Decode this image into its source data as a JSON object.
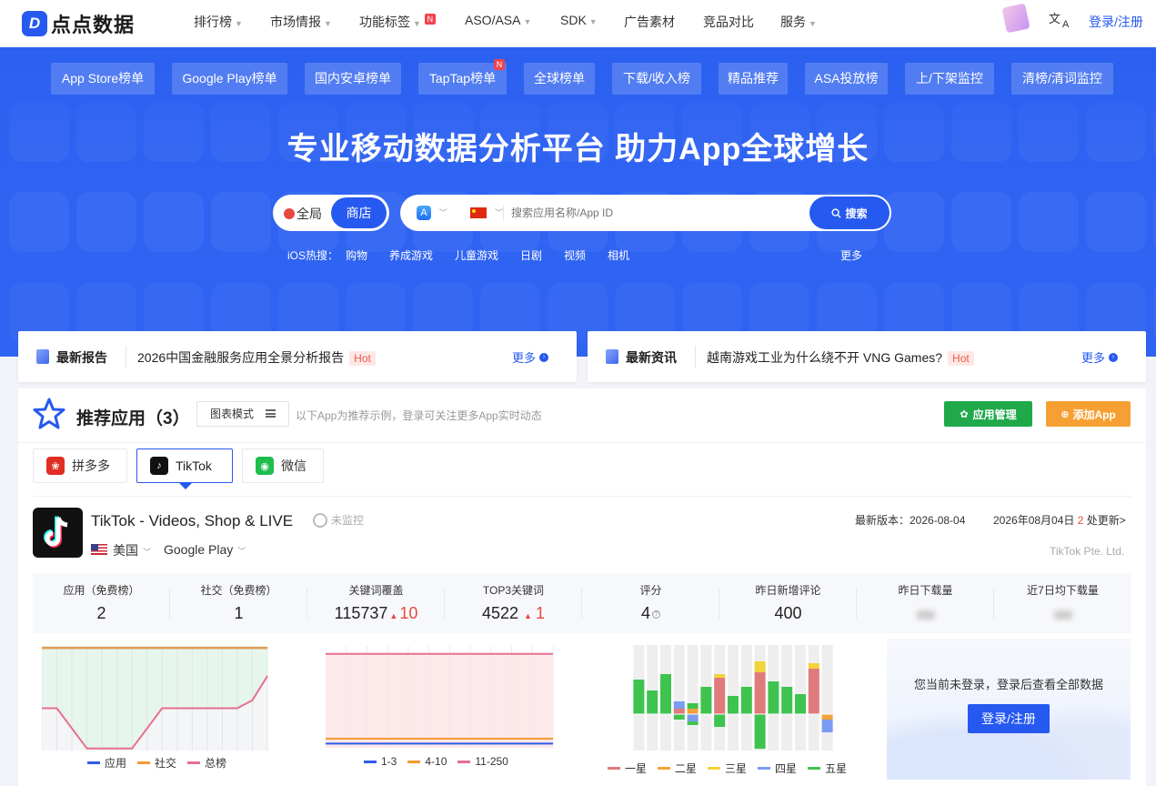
{
  "brand": {
    "logo_mark": "D",
    "name": "点点数据"
  },
  "nav": {
    "items": [
      {
        "label": "排行榜",
        "caret": true
      },
      {
        "label": "市场情报",
        "caret": true
      },
      {
        "label": "功能标签",
        "caret": true,
        "badge": "N"
      },
      {
        "label": "ASO/ASA",
        "caret": true
      },
      {
        "label": "SDK",
        "caret": true
      },
      {
        "label": "广告素材",
        "caret": false
      },
      {
        "label": "竞品对比",
        "caret": false
      },
      {
        "label": "服务",
        "caret": true
      }
    ],
    "lang_icon_top": "文",
    "lang_icon_bottom": "A",
    "login": "登录/注册"
  },
  "hero": {
    "tabs": [
      "App Store榜单",
      "Google Play榜单",
      "国内安卓榜单",
      "TapTap榜单",
      "全球榜单",
      "下载/收入榜",
      "精品推荐",
      "ASA投放榜",
      "上/下架监控",
      "清榜/清词监控"
    ],
    "taptap_badge": "N",
    "title": "专业移动数据分析平台  助力App全球增长",
    "scope_all": "全局",
    "scope_store": "商店",
    "search_placeholder": "搜索应用名称/App ID",
    "search_button": "搜索",
    "hot_label": "iOS热搜：",
    "hot_terms": [
      "购物",
      "养成游戏",
      "儿童游戏",
      "日剧",
      "视频",
      "相机"
    ],
    "more": "更多"
  },
  "news": [
    {
      "title": "最新报告",
      "text": "2026中国金融服务应用全景分析报告",
      "tag": "Hot",
      "more": "更多"
    },
    {
      "title": "最新资讯",
      "text": "越南游戏工业为什么绕不开 VNG Games?",
      "tag": "Hot",
      "more": "更多"
    }
  ],
  "recommend": {
    "title": "推荐应用（3）",
    "mode": "图表模式",
    "hint": "以下App为推荐示例，登录可关注更多App实时动态",
    "manage_btn": "应用管理",
    "add_btn": "添加App",
    "tabs": [
      {
        "label": "拼多多",
        "color": "#e02e24"
      },
      {
        "label": "TikTok",
        "color": "#111111"
      },
      {
        "label": "微信",
        "color": "#1fbd4e"
      }
    ]
  },
  "app": {
    "name": "TikTok - Videos, Shop & LIVE",
    "monitor": "未监控",
    "country": "美国",
    "platform": "Google Play",
    "version": "最新版本：2026-08-04",
    "update_prefix": "2026年08月04日 ",
    "update_count": "2",
    "update_suffix": " 处更新>",
    "developer": "TikTok Pte. Ltd."
  },
  "stats": [
    {
      "label": "应用（免费榜）",
      "value": "2"
    },
    {
      "label": "社交（免费榜）",
      "value": "1"
    },
    {
      "label": "关键词覆盖",
      "value": "115737",
      "delta": "10"
    },
    {
      "label": "TOP3关键词",
      "value": "4522",
      "delta": "1"
    },
    {
      "label": "评分",
      "value": "4"
    },
    {
      "label": "昨日新增评论",
      "value": "400"
    },
    {
      "label": "昨日下载量",
      "value": ""
    },
    {
      "label": "近7日均下载量",
      "value": ""
    }
  ],
  "chart_data": [
    {
      "type": "line",
      "series": [
        {
          "name": "应用",
          "color": "#2f5bea",
          "values": [
            1,
            1,
            1,
            1,
            1,
            1,
            1,
            1,
            1,
            1,
            1,
            1,
            1,
            1,
            1,
            1
          ]
        },
        {
          "name": "社交",
          "color": "#f39b33",
          "values": [
            1,
            1,
            1,
            1,
            1,
            1,
            1,
            1,
            1,
            1,
            1,
            1,
            1,
            1,
            1,
            1
          ]
        },
        {
          "name": "总榜",
          "color": "#e6708f",
          "values": [
            4,
            4,
            5,
            6,
            6,
            6,
            6,
            5,
            4,
            4,
            4,
            4,
            4,
            4,
            3.6,
            2.4
          ]
        }
      ],
      "ylim": [
        0.9,
        6.1
      ]
    },
    {
      "type": "line",
      "series": [
        {
          "name": "1-3",
          "color": "#2f5bea",
          "values": [
            4522,
            4522,
            4522,
            4522,
            4522,
            4522,
            4522,
            4522,
            4522,
            4522,
            4522,
            4522
          ]
        },
        {
          "name": "4-10",
          "color": "#f39b33",
          "values": [
            9800,
            9800,
            9800,
            9800,
            9800,
            9800,
            9800,
            9800,
            9800,
            9800,
            9800,
            9800
          ]
        },
        {
          "name": "11-250",
          "color": "#e6708f",
          "values": [
            101400,
            101400,
            101400,
            101400,
            101400,
            101400,
            101400,
            101400,
            101400,
            101400,
            101400,
            101400
          ]
        }
      ],
      "ylim": [
        0,
        110000
      ]
    },
    {
      "type": "bar",
      "stacked": true,
      "series": [
        {
          "name": "一星",
          "color": "#e07b7b"
        },
        {
          "name": "二星",
          "color": "#f2a33a"
        },
        {
          "name": "三星",
          "color": "#f3d33a"
        },
        {
          "name": "四星",
          "color": "#7b9cf0"
        },
        {
          "name": "五星",
          "color": "#3fc34f"
        }
      ],
      "bars": [
        {
          "pos": [
            0,
            0,
            0,
            0,
            38
          ],
          "neg": [
            0,
            0,
            0,
            0,
            0
          ]
        },
        {
          "pos": [
            0,
            0,
            0,
            0,
            26
          ],
          "neg": [
            0,
            0,
            0,
            0,
            0
          ]
        },
        {
          "pos": [
            0,
            0,
            0,
            0,
            44
          ],
          "neg": [
            0,
            0,
            0,
            0,
            0
          ]
        },
        {
          "pos": [
            6,
            0,
            0,
            8,
            0
          ],
          "neg": [
            0,
            0,
            0,
            0,
            6
          ]
        },
        {
          "pos": [
            0,
            6,
            0,
            0,
            6
          ],
          "neg": [
            0,
            0,
            0,
            8,
            4
          ]
        },
        {
          "pos": [
            0,
            0,
            0,
            0,
            30
          ],
          "neg": [
            0,
            0,
            0,
            0,
            0
          ]
        },
        {
          "pos": [
            40,
            0,
            4,
            0,
            0
          ],
          "neg": [
            0,
            0,
            0,
            0,
            14
          ]
        },
        {
          "pos": [
            0,
            0,
            0,
            0,
            20
          ],
          "neg": [
            0,
            0,
            0,
            0,
            0
          ]
        },
        {
          "pos": [
            0,
            0,
            0,
            0,
            30
          ],
          "neg": [
            0,
            0,
            0,
            0,
            0
          ]
        },
        {
          "pos": [
            46,
            0,
            12,
            0,
            0
          ],
          "neg": [
            0,
            0,
            0,
            0,
            38
          ]
        },
        {
          "pos": [
            0,
            0,
            0,
            0,
            36
          ],
          "neg": [
            0,
            0,
            0,
            0,
            0
          ]
        },
        {
          "pos": [
            0,
            0,
            0,
            0,
            30
          ],
          "neg": [
            0,
            0,
            0,
            0,
            0
          ]
        },
        {
          "pos": [
            0,
            0,
            0,
            0,
            22
          ],
          "neg": [
            0,
            0,
            0,
            0,
            0
          ]
        },
        {
          "pos": [
            50,
            0,
            6,
            0,
            0
          ],
          "neg": [
            0,
            0,
            0,
            0,
            0
          ]
        },
        {
          "pos": [
            0,
            0,
            0,
            0,
            0
          ],
          "neg": [
            0,
            6,
            0,
            14,
            0
          ]
        }
      ],
      "ylim": [
        -40,
        76
      ]
    }
  ],
  "lock": {
    "message": "您当前未登录，登录后查看全部数据",
    "button": "登录/注册"
  }
}
